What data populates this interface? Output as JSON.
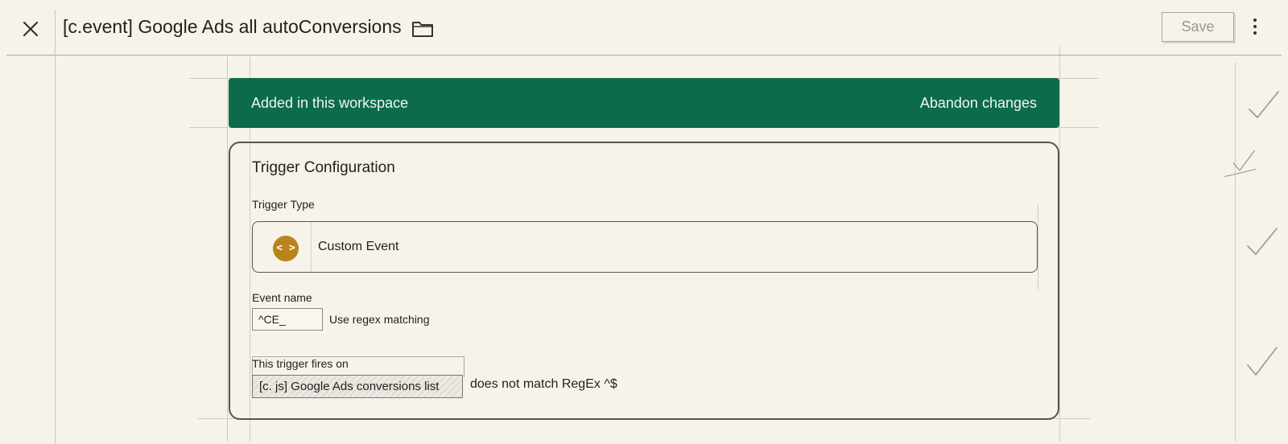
{
  "header": {
    "title": "[c.event] Google Ads all autoConversions",
    "save_label": "Save"
  },
  "banner": {
    "message": "Added in this workspace",
    "action_label": "Abandon changes",
    "color": "#0b6b4a"
  },
  "trigger_config": {
    "heading": "Trigger Configuration",
    "trigger_type_label": "Trigger Type",
    "trigger_type_value": "Custom Event",
    "trigger_type_icon": "code-brackets-icon",
    "trigger_icon_color": "#b8841e",
    "event_name_label": "Event name",
    "event_name_value": "^CE_",
    "regex_label": "Use regex matching",
    "fires_on_label": "This trigger fires on",
    "condition_variable": "[c. js] Google Ads conversions list",
    "condition_text": "does not match RegEx ^$"
  }
}
